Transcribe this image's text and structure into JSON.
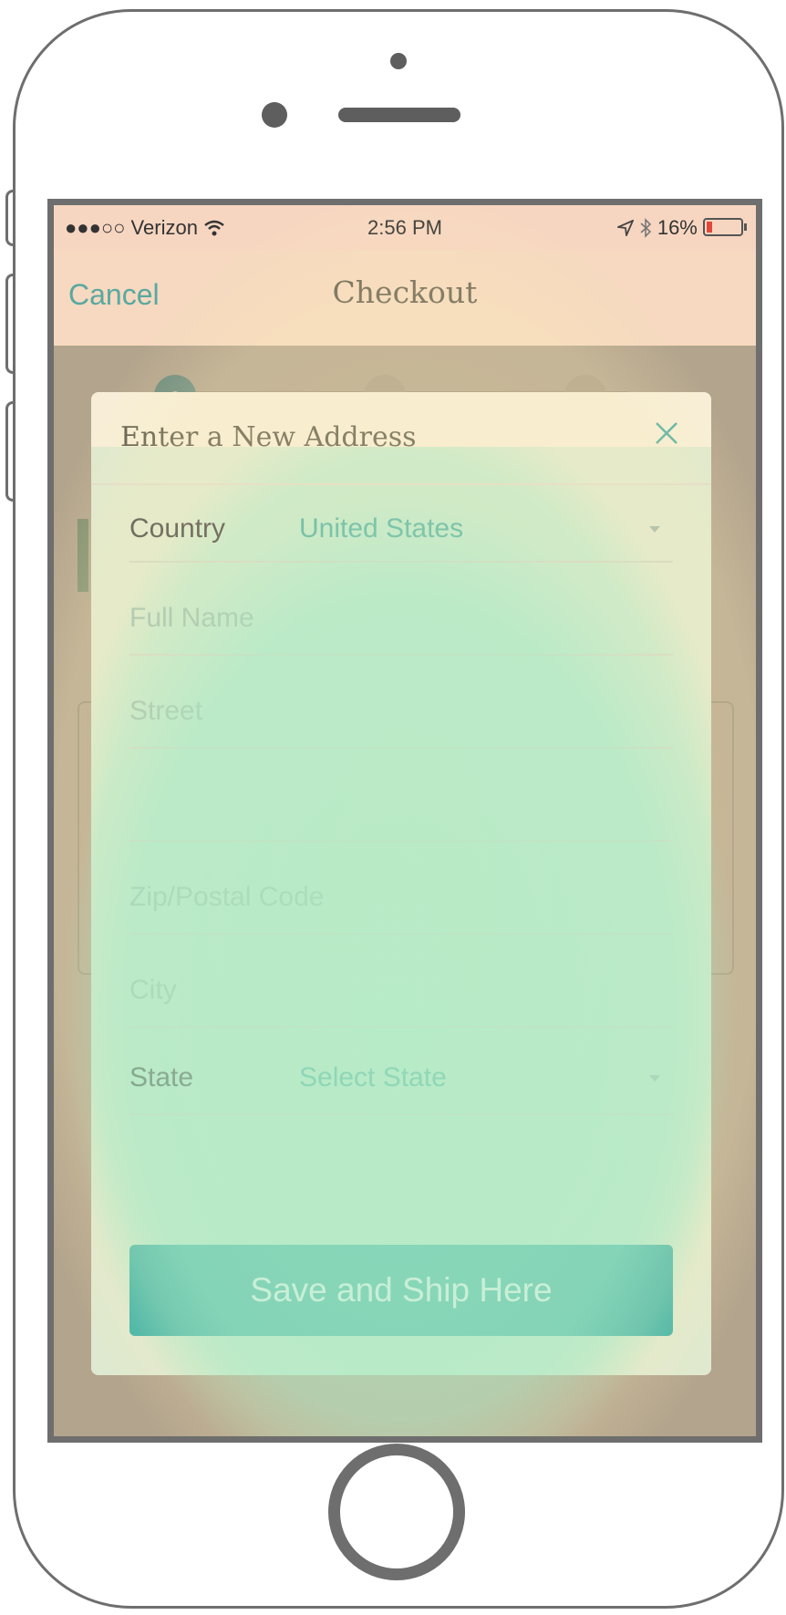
{
  "status_bar": {
    "carrier": "●●●○○ Verizon",
    "time": "2:56 PM",
    "battery": "16%"
  },
  "nav": {
    "cancel_label": "Cancel",
    "title": "Checkout"
  },
  "modal": {
    "title": "Enter a New Address",
    "country_label": "Country",
    "country_value": "United States",
    "full_name_placeholder": "Full Name",
    "street_placeholder": "Street",
    "street2_placeholder": "",
    "zip_placeholder": "Zip/Postal Code",
    "city_placeholder": "City",
    "state_label": "State",
    "state_value": "Select State",
    "save_label": "Save and Ship Here"
  },
  "colors": {
    "accent": "#3bb2a6",
    "link": "#5aa8a0",
    "nav_bg": "#f6d9c0"
  },
  "icons": [
    "wifi-icon",
    "location-arrow-icon",
    "bluetooth-icon",
    "battery-icon",
    "close-icon",
    "chevron-down-icon"
  ]
}
